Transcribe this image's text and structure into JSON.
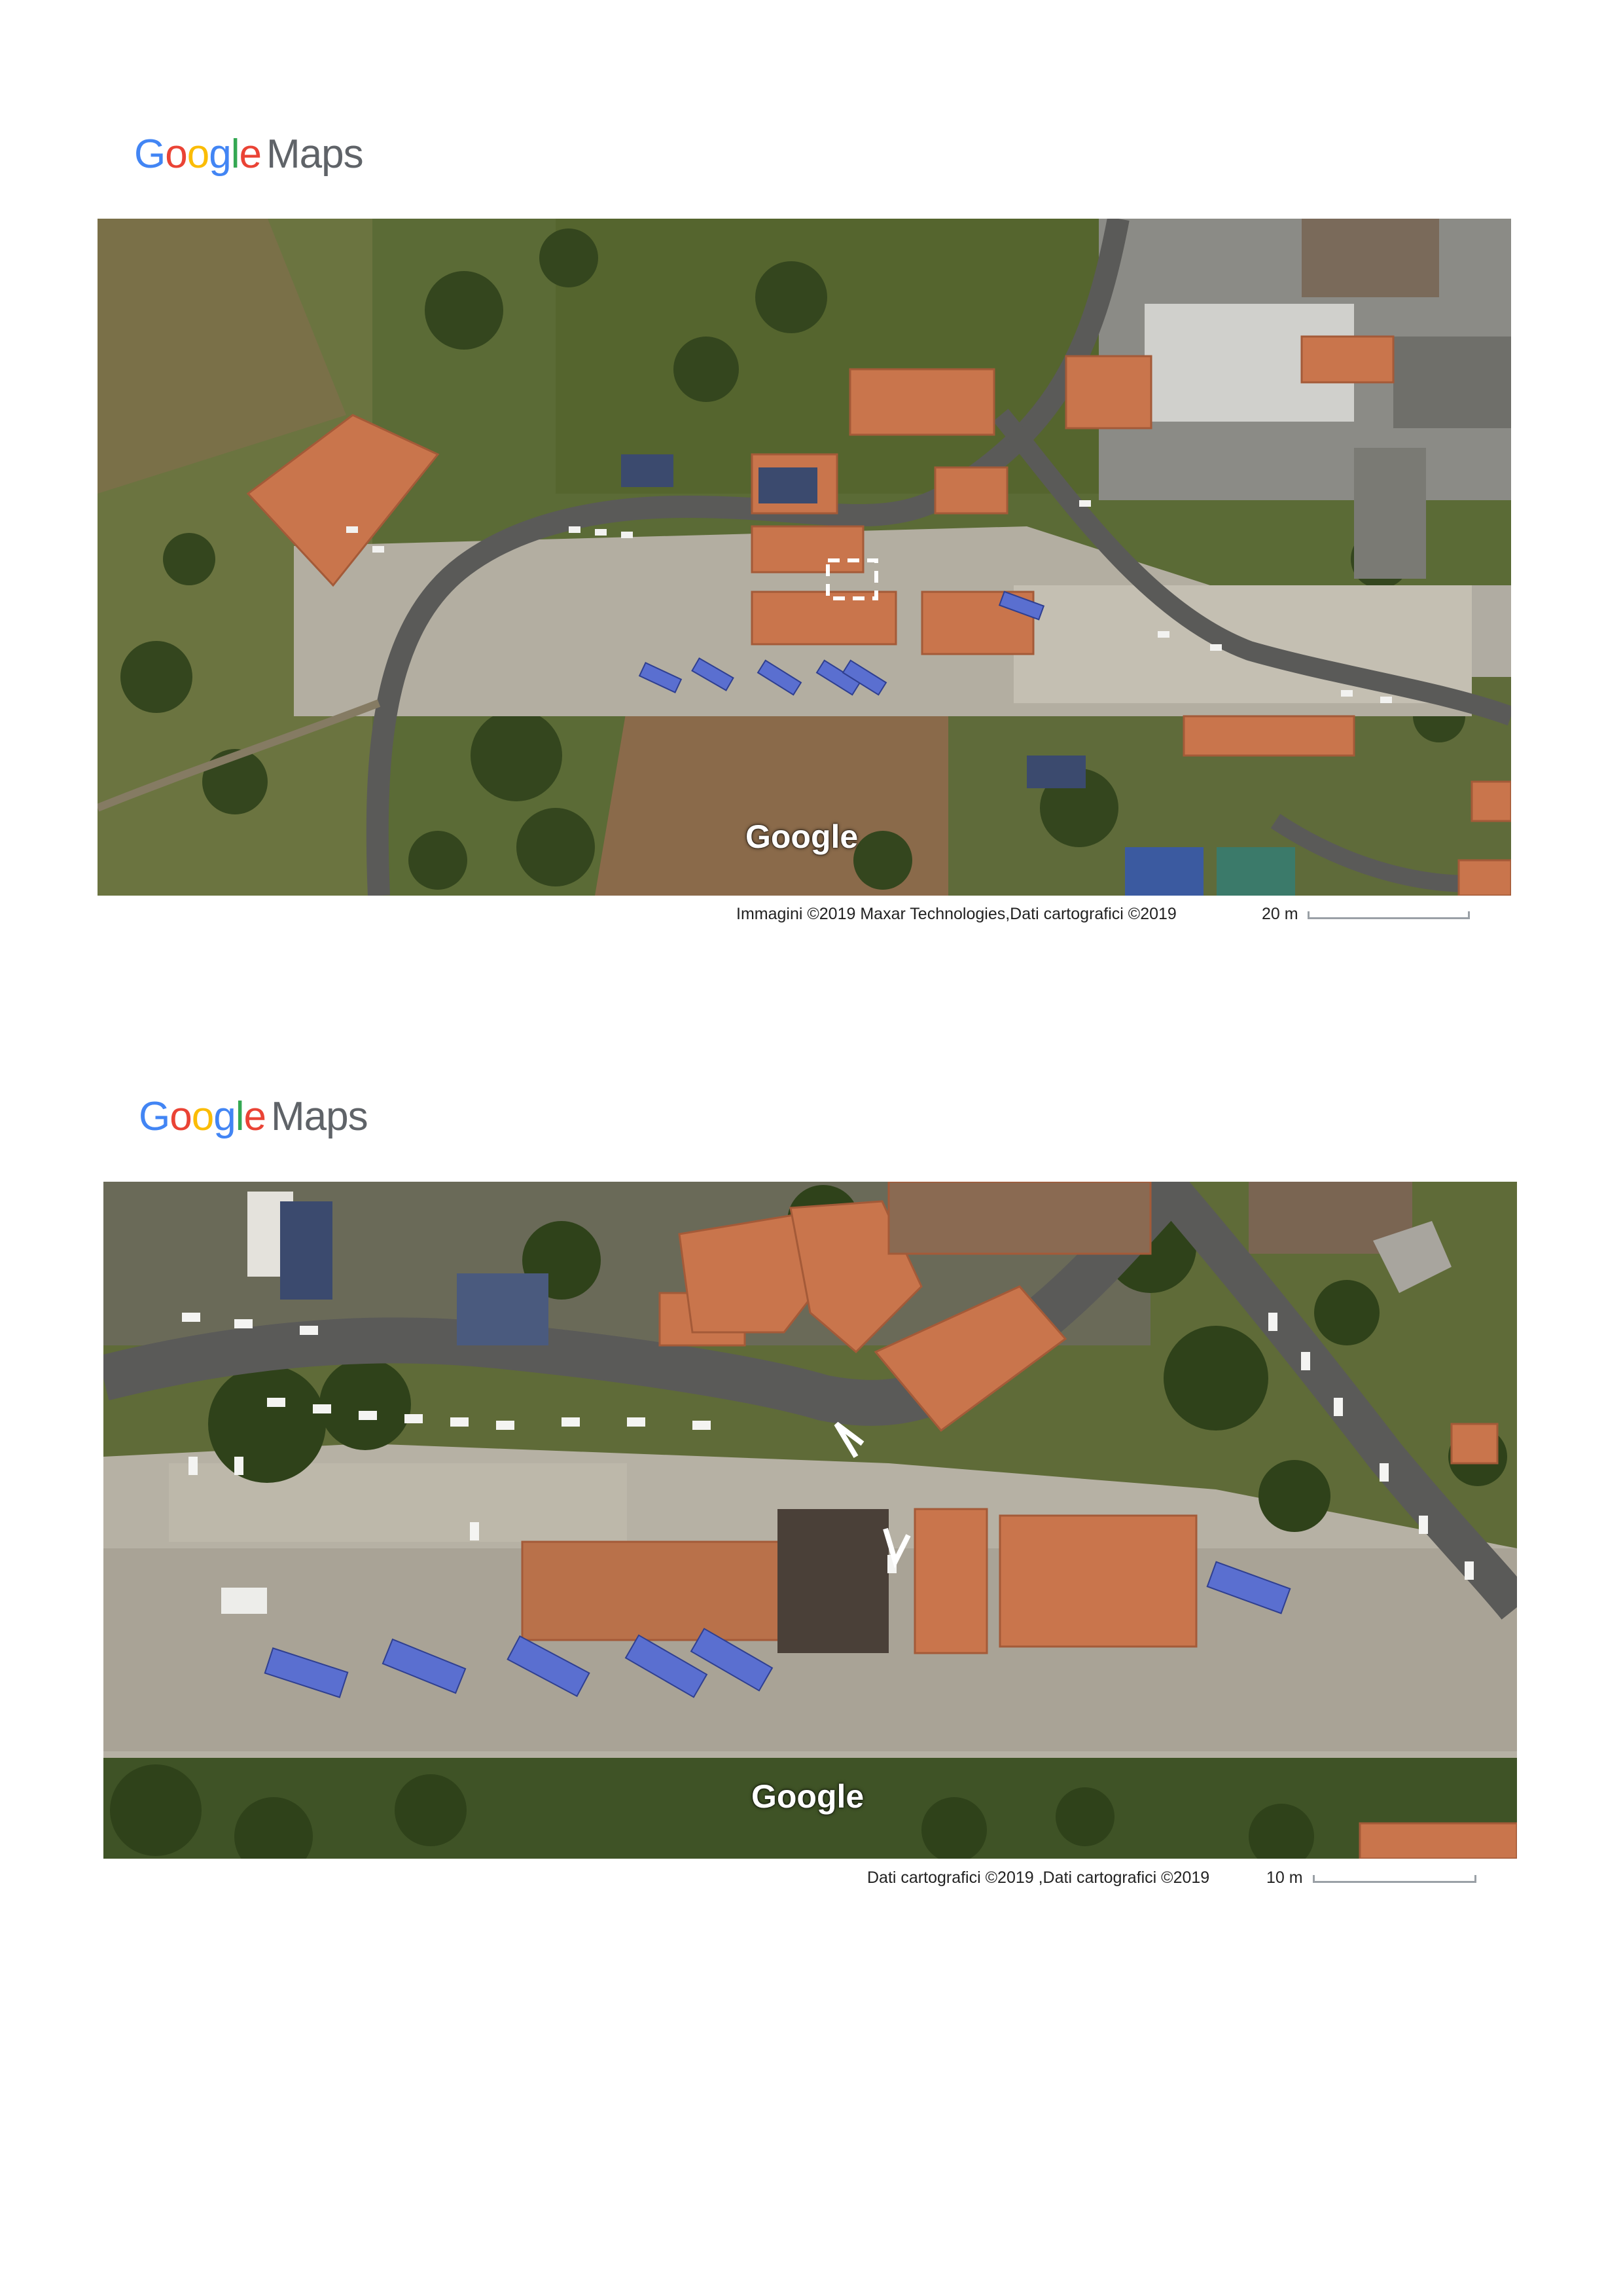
{
  "colors": {
    "google_blue": "#4285F4",
    "google_red": "#EA4335",
    "google_yellow": "#FBBC05",
    "google_green": "#34A853",
    "maps_gray": "#5f6368"
  },
  "logo_letters": [
    "G",
    "o",
    "o",
    "g",
    "l",
    "e"
  ],
  "logo_maps": "Maps",
  "maps": [
    {
      "watermark": "Google",
      "attribution": "Immagini ©2019 Maxar Technologies,Dati cartografici ©2019",
      "scale_label": "20 m"
    },
    {
      "watermark": "Google",
      "attribution": "Dati cartografici ©2019 ,Dati cartografici ©2019",
      "scale_label": "10 m"
    }
  ]
}
